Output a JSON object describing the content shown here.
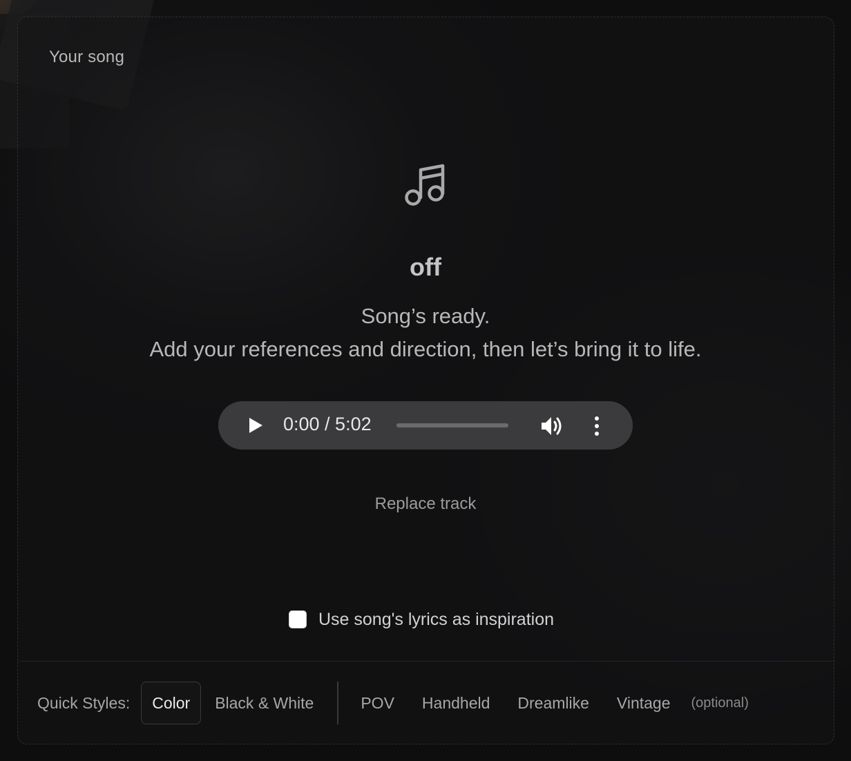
{
  "panel": {
    "label": "Your song"
  },
  "song": {
    "title": "off",
    "status_line1": "Song’s ready.",
    "status_line2": "Add your references and direction, then let’s bring it to life."
  },
  "player": {
    "current_time": "0:00",
    "duration": "5:02",
    "time_display": "0:00 / 5:02",
    "progress": 0
  },
  "replace_label": "Replace track",
  "lyrics_option": {
    "label": "Use song's lyrics as inspiration",
    "checked": false
  },
  "quick_styles": {
    "label": "Quick Styles:",
    "color_styles": [
      "Color",
      "Black & White"
    ],
    "selected": "Color",
    "camera_styles": [
      "POV",
      "Handheld",
      "Dreamlike",
      "Vintage"
    ],
    "optional_note": "(optional)"
  },
  "icons": {
    "music": "music-note-icon",
    "play": "play-icon",
    "volume": "volume-icon",
    "more": "more-vertical-icon"
  }
}
